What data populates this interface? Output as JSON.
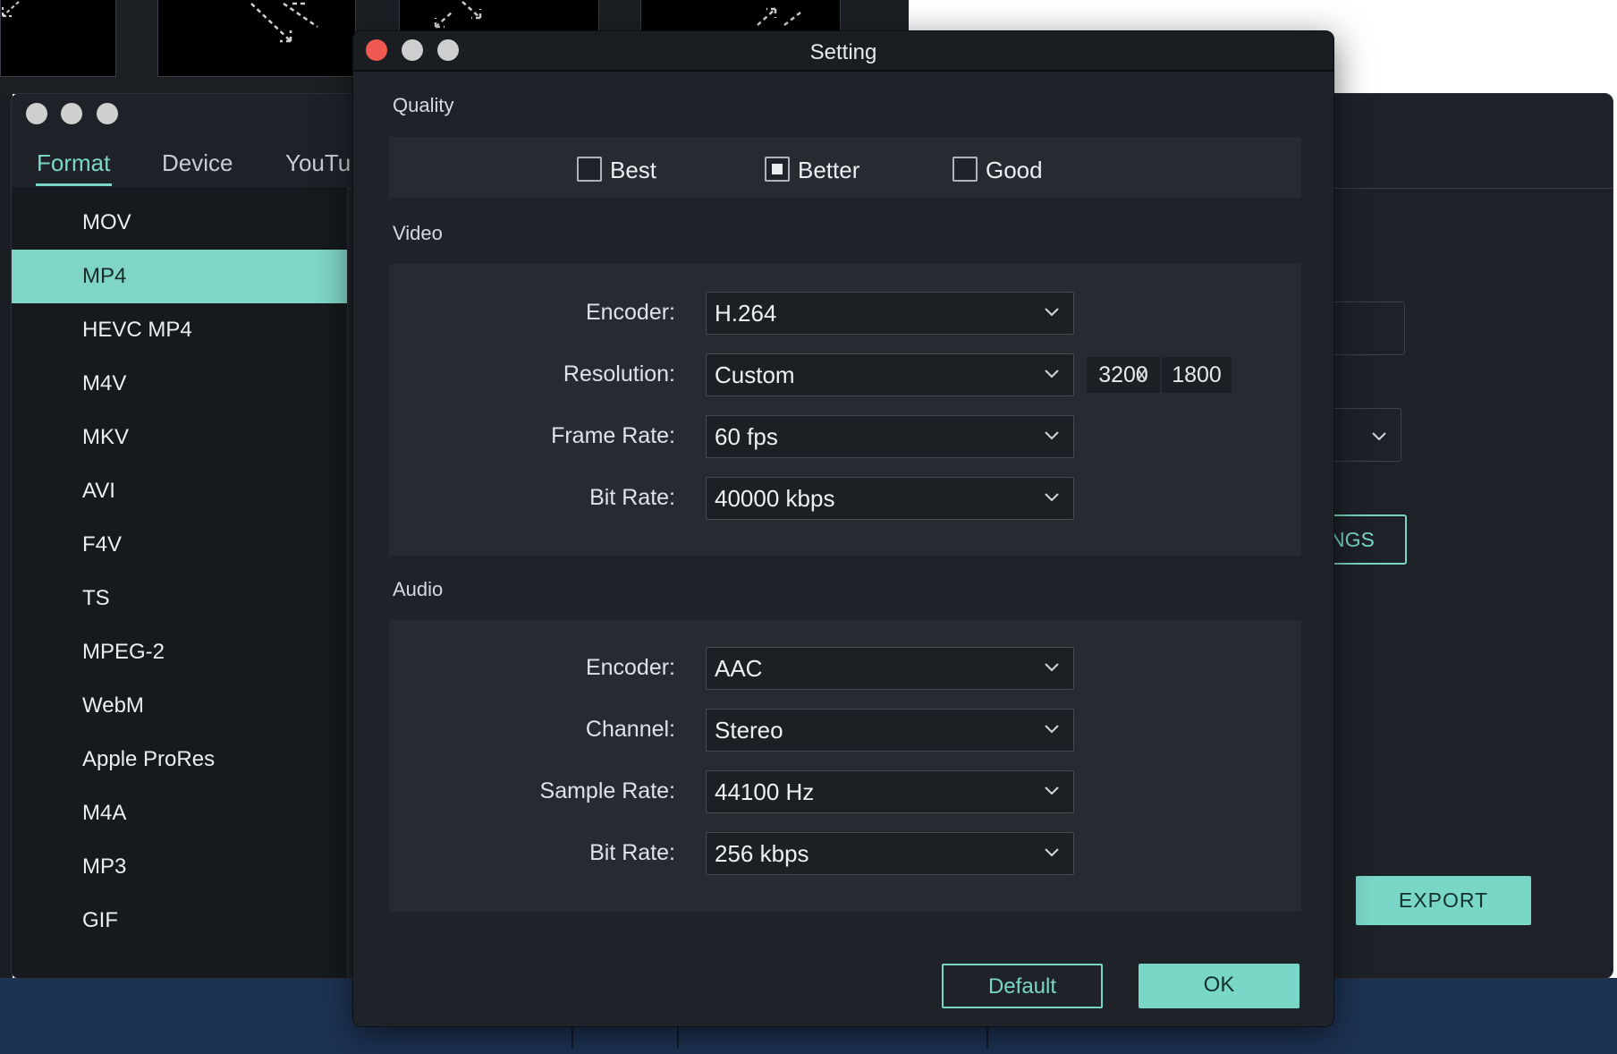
{
  "export_window": {
    "tabs": [
      {
        "label": "Format"
      },
      {
        "label": "Device"
      },
      {
        "label": "YouTul"
      }
    ],
    "formats": [
      "MOV",
      "MP4",
      "HEVC MP4",
      "M4V",
      "MKV",
      "AVI",
      "F4V",
      "TS",
      "MPEG-2",
      "WebM",
      "Apple ProRes",
      "M4A",
      "MP3",
      "GIF"
    ],
    "selected_format": "MP4",
    "settings_button_partial": "NGS",
    "export_button": "EXPORT"
  },
  "dialog": {
    "title": "Setting",
    "quality": {
      "label": "Quality",
      "options": [
        {
          "label": "Best",
          "checked": false
        },
        {
          "label": "Better",
          "checked": true
        },
        {
          "label": "Good",
          "checked": false
        }
      ]
    },
    "video": {
      "label": "Video",
      "encoder_label": "Encoder:",
      "encoder": "H.264",
      "resolution_label": "Resolution:",
      "resolution": "Custom",
      "width": "3200",
      "x_sep": "x",
      "height": "1800",
      "frame_rate_label": "Frame Rate:",
      "frame_rate": "60 fps",
      "bit_rate_label": "Bit Rate:",
      "bit_rate": "40000 kbps"
    },
    "audio": {
      "label": "Audio",
      "encoder_label": "Encoder:",
      "encoder": "AAC",
      "channel_label": "Channel:",
      "channel": "Stereo",
      "sample_rate_label": "Sample Rate:",
      "sample_rate": "44100 Hz",
      "bit_rate_label": "Bit Rate:",
      "bit_rate": "256 kbps"
    },
    "buttons": {
      "default": "Default",
      "ok": "OK"
    }
  },
  "colors": {
    "accent": "#79d7c8",
    "close": "#ee5a52",
    "inactive_dot": "#cfcfcf"
  }
}
